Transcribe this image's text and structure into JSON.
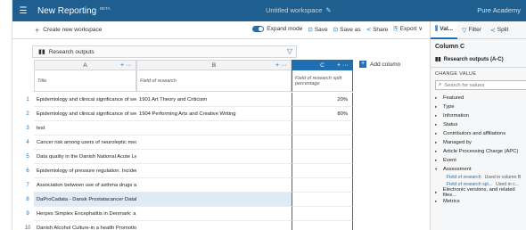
{
  "topbar": {
    "app_title": "New Reporting",
    "beta": "BETA",
    "workspace_title": "Untitled workspace",
    "org": "Pure Academy"
  },
  "toolbar": {
    "create_workspace": "Create new workspace",
    "expand_mode": "Expand mode",
    "save": "Save",
    "save_as": "Save as",
    "share": "Share",
    "export": "Export"
  },
  "dataset": {
    "label": "Research outputs"
  },
  "columns": [
    {
      "letter": "A",
      "field": "Title"
    },
    {
      "letter": "B",
      "field": "Field of research"
    },
    {
      "letter": "C",
      "field": "Field of research split percentage"
    }
  ],
  "add_column": "Add column",
  "rows": [
    {
      "n": "1",
      "a": "Epidemiology and clinical significance of second...",
      "b": "1901 Art Theory and Criticism",
      "c": "20%"
    },
    {
      "n": "2",
      "a": "Epidemiology and clinical significance of second...",
      "b": "1904 Performing Arts and Creative Writing",
      "c": "80%"
    },
    {
      "n": "3",
      "a": "test",
      "b": "",
      "c": ""
    },
    {
      "n": "4",
      "a": "Cancer risk among users of neuroleptic medicati...",
      "b": "",
      "c": ""
    },
    {
      "n": "5",
      "a": "Data quality in the Danish National Acute Leuke...",
      "b": "",
      "c": ""
    },
    {
      "n": "6",
      "a": "Epidemiology of pressure regulation. Incidence ...",
      "b": "",
      "c": ""
    },
    {
      "n": "7",
      "a": "Association between use of asthma drugs and pr...",
      "b": "",
      "c": ""
    },
    {
      "n": "8",
      "a": "DaProCadata - Dansk Prostatacancer Database",
      "b": "",
      "c": ""
    },
    {
      "n": "9",
      "a": "Herpes Simplex Encephalitis in Denmark: a nati...",
      "b": "",
      "c": ""
    },
    {
      "n": "10",
      "a": "Danish Alcohol Culture-in a health Promotion P...",
      "b": "",
      "c": ""
    }
  ],
  "panel": {
    "tabs": [
      "Val...",
      "Filter",
      "Split"
    ],
    "column_title": "Column C",
    "dataset": "Research outputs (A-C)",
    "change_value": "CHANGE VALUE",
    "search_placeholder": "Search for values",
    "items": [
      "Featured",
      "Type",
      "Information",
      "Status",
      "Contributors and affiliations",
      "Managed by",
      "Article Processing Charge (APC)",
      "Event",
      "Assessment"
    ],
    "sub_items": [
      {
        "link": "Field of research",
        "note": "Used in column B"
      },
      {
        "link": "Field of research spl...",
        "note": "Used in c..."
      }
    ],
    "items_after": [
      "Electronic versions, and related files...",
      "Metrics"
    ]
  },
  "colors": {
    "brand": "#1f5f8f",
    "accent": "#1f6fb2",
    "highlight_row": "#dfeaf5"
  }
}
